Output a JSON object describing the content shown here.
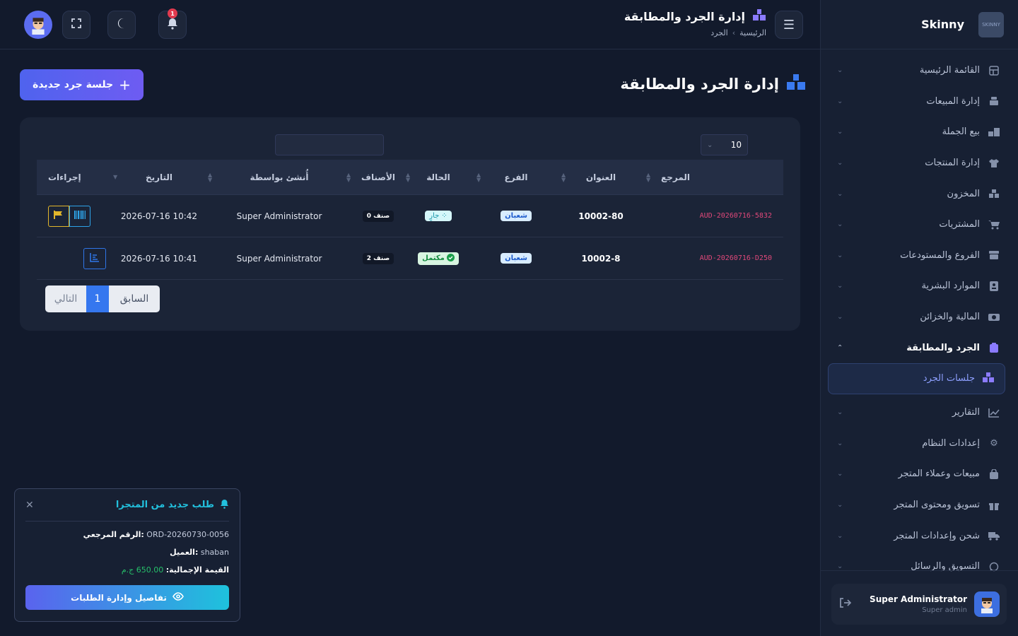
{
  "sidebar": {
    "brand": "Skinny",
    "logo_text": "SKINNY",
    "items": [
      {
        "label": "القائمة الرئيسية",
        "icon": "grid-icon"
      },
      {
        "label": "إدارة المبيعات",
        "icon": "register-icon"
      },
      {
        "label": "بيع الجملة",
        "icon": "boxes-icon"
      },
      {
        "label": "إدارة المنتجات",
        "icon": "shirt-icon"
      },
      {
        "label": "المخزون",
        "icon": "stack-icon"
      },
      {
        "label": "المشتريات",
        "icon": "cart-icon"
      },
      {
        "label": "الفروع والمستودعات",
        "icon": "store-icon"
      },
      {
        "label": "الموارد البشرية",
        "icon": "id-badge-icon"
      },
      {
        "label": "المالية والخزائن",
        "icon": "money-icon"
      },
      {
        "label": "الجرد والمطابقة",
        "icon": "clipboard-icon",
        "active": true
      },
      {
        "label": "التقارير",
        "icon": "chart-icon"
      },
      {
        "label": "إعدادات النظام",
        "icon": "gear-icon"
      },
      {
        "label": "مبيعات وعملاء المتجر",
        "icon": "bag-icon"
      },
      {
        "label": "تسويق ومحتوى المتجر",
        "icon": "gift-icon"
      },
      {
        "label": "شحن وإعدادات المتجر",
        "icon": "truck-icon"
      },
      {
        "label": "التسويق والرسائل",
        "icon": "whatsapp-icon"
      }
    ],
    "sub_item": "جلسات الجرد",
    "user": {
      "name": "Super Administrator",
      "role": "Super admin"
    }
  },
  "topbar": {
    "title": "إدارة الجرد والمطابقة",
    "breadcrumb_home": "الرئيسية",
    "breadcrumb_current": "الجرد",
    "notification_count": "1"
  },
  "page": {
    "title": "إدارة الجرد والمطابقة",
    "new_button": "جلسة جرد جديدة"
  },
  "table": {
    "page_length": "10",
    "headers": {
      "ref": "المرجع",
      "title": "العنوان",
      "branch": "الفرع",
      "status": "الحالة",
      "items": "الأصناف",
      "created_by": "أُنشئ بواسطة",
      "date": "التاريخ",
      "actions": "إجراءات"
    },
    "rows": [
      {
        "ref": "AUD-20260716-5832",
        "title": "10002-80",
        "branch": "شعبان",
        "status": "جارٍ",
        "items": "0 صنف",
        "created_by": "Super Administrator",
        "date": "2026-07-16 10:42"
      },
      {
        "ref": "AUD-20260716-D250",
        "title": "10002-8",
        "branch": "شعبان",
        "status": "مكتمل",
        "items": "2 صنف",
        "created_by": "Super Administrator",
        "date": "2026-07-16 10:41"
      }
    ],
    "pager": {
      "prev": "السابق",
      "page": "1",
      "next": "التالي"
    }
  },
  "toast": {
    "title": "طلب جديد من المتجرا",
    "ref_label": "الرقم المرجعي:",
    "ref_value": "ORD-20260730-0056",
    "customer_label": "العميل:",
    "customer_value": "shaban",
    "total_label": "القيمة الإجمالية:",
    "total_value": "650.00 ج.م",
    "button": "تفاصيل وإدارة الطلبات"
  },
  "colors": {
    "accent": "#4f63ee",
    "reference": "#e0487a",
    "toast_accent": "#22c0dd"
  }
}
